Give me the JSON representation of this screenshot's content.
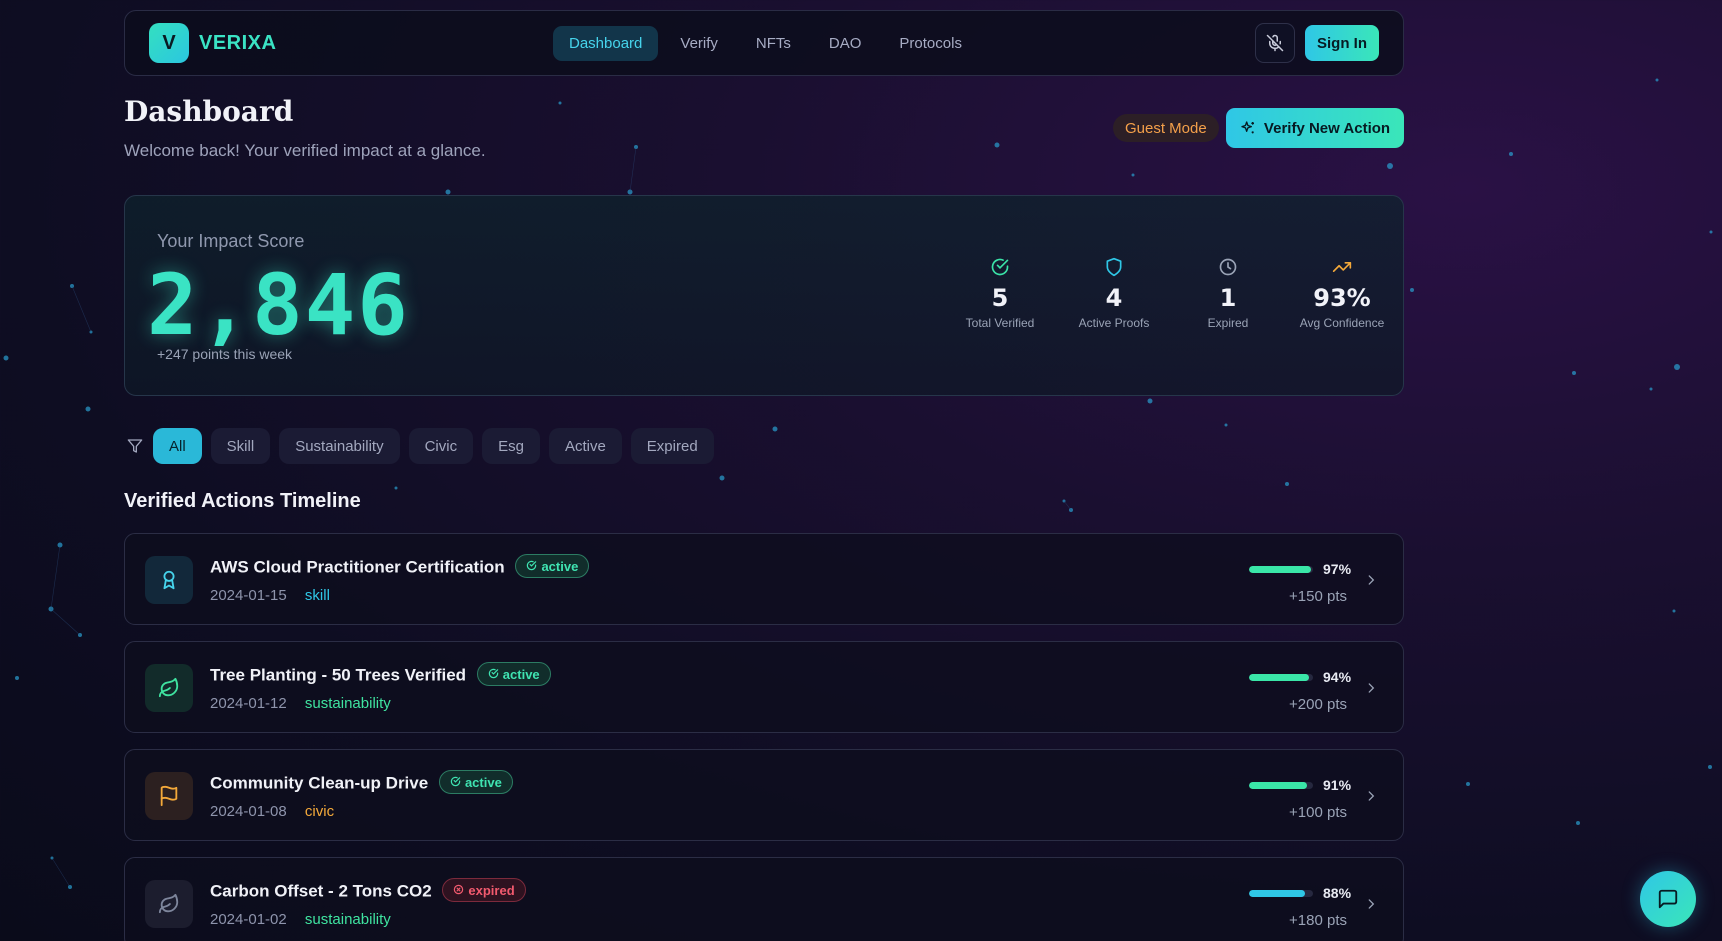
{
  "brand": {
    "logo_letter": "V",
    "name": "VERIXA"
  },
  "nav": {
    "links": [
      "Dashboard",
      "Verify",
      "NFTs",
      "DAO",
      "Protocols"
    ],
    "active": "Dashboard",
    "sign_in_label": "Sign In",
    "mic_icon": "mic-off-icon"
  },
  "header": {
    "title": "Dashboard",
    "subtitle": "Welcome back! Your verified impact at a glance.",
    "guest_badge": "Guest Mode",
    "verify_button": "Verify New Action"
  },
  "score": {
    "label": "Your Impact Score",
    "value": "2,846",
    "delta": "+247 points this week",
    "stats": [
      {
        "value": "5",
        "label": "Total Verified",
        "icon": "check-circle-icon",
        "color": "#3ae3a8"
      },
      {
        "value": "4",
        "label": "Active Proofs",
        "icon": "shield-icon",
        "color": "#2fc7e6"
      },
      {
        "value": "1",
        "label": "Expired",
        "icon": "clock-icon",
        "color": "#9aa3b6"
      },
      {
        "value": "93%",
        "label": "Avg Confidence",
        "icon": "trending-up-icon",
        "color": "#f4a93a"
      }
    ]
  },
  "filters": [
    "All",
    "Skill",
    "Sustainability",
    "Civic",
    "Esg",
    "Active",
    "Expired"
  ],
  "active_filter": "All",
  "timeline": {
    "title": "Verified Actions Timeline",
    "items": [
      {
        "title": "AWS Cloud Practitioner Certification",
        "status": "active",
        "date": "2024-01-15",
        "category": "skill",
        "category_color": "#2fc7e6",
        "confidence": 0.97,
        "confidence_label": "97%",
        "points": "+150 pts",
        "icon": "award-icon",
        "icon_color": "#46d4ec",
        "icon_bg": "#12283a",
        "bar_color": "#3ae6a8"
      },
      {
        "title": "Tree Planting - 50 Trees Verified",
        "status": "active",
        "date": "2024-01-12",
        "category": "sustainability",
        "category_color": "#3fe3a0",
        "confidence": 0.94,
        "confidence_label": "94%",
        "points": "+200 pts",
        "icon": "leaf-icon",
        "icon_color": "#3fe3a0",
        "icon_bg": "#122b2a",
        "bar_color": "#3ae6a8"
      },
      {
        "title": "Community Clean-up Drive",
        "status": "active",
        "date": "2024-01-08",
        "category": "civic",
        "category_color": "#f4a93a",
        "confidence": 0.91,
        "confidence_label": "91%",
        "points": "+100 pts",
        "icon": "flag-icon",
        "icon_color": "#f4a93a",
        "icon_bg": "#2c2020",
        "bar_color": "#3ae6a8"
      },
      {
        "title": "Carbon Offset - 2 Tons CO2",
        "status": "expired",
        "date": "2024-01-02",
        "category": "sustainability",
        "category_color": "#3fe3a0",
        "confidence": 0.88,
        "confidence_label": "88%",
        "points": "+180 pts",
        "icon": "leaf-icon",
        "icon_color": "#7e869c",
        "icon_bg": "#1c1d2e",
        "bar_color": "#2fc7e6"
      }
    ]
  },
  "chat_icon": "chat-bubble-icon"
}
